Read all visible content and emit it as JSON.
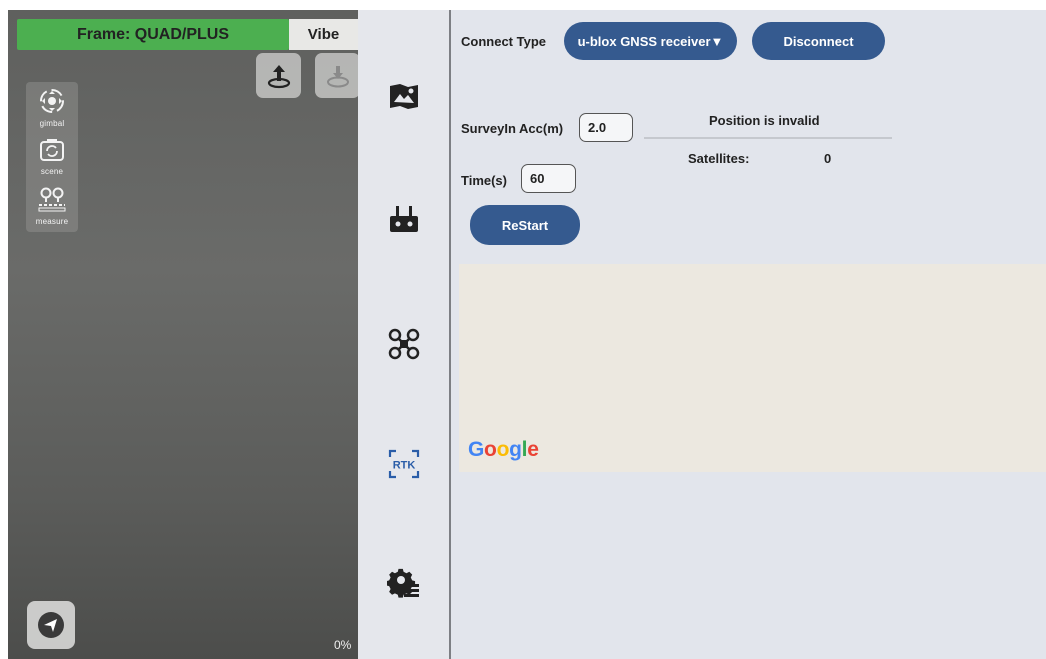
{
  "left": {
    "frame_label": "Frame: QUAD/PLUS",
    "vibe_label": "Vibe",
    "tools": [
      {
        "icon": "gimbal-icon",
        "label": "gimbal"
      },
      {
        "icon": "scene-icon",
        "label": "scene"
      },
      {
        "icon": "measure-icon",
        "label": "measure"
      }
    ],
    "percent": "0%"
  },
  "nav": {
    "items": [
      {
        "icon": "map-photo-icon"
      },
      {
        "icon": "remote-controller-icon"
      },
      {
        "icon": "drone-icon"
      },
      {
        "icon": "rtk-icon",
        "text": "RTK"
      },
      {
        "icon": "settings-gear-icon"
      }
    ]
  },
  "connect": {
    "type_label": "Connect Type",
    "type_value": "u-blox GNSS receiver▼",
    "disconnect_label": "Disconnect"
  },
  "survey": {
    "acc_label": "SurveyIn Acc(m)",
    "acc_value": "2.0",
    "time_label": "Time(s)",
    "time_value": "60",
    "restart_label": "ReStart"
  },
  "status": {
    "position_text": "Position is invalid",
    "satellites_label": "Satellites:",
    "satellites_value": "0"
  },
  "map": {
    "logo_letters": [
      "G",
      "o",
      "o",
      "g",
      "l",
      "e"
    ],
    "logo_colors": [
      "#4285F4",
      "#EA4335",
      "#FBBC05",
      "#4285F4",
      "#34A853",
      "#EA4335"
    ]
  }
}
